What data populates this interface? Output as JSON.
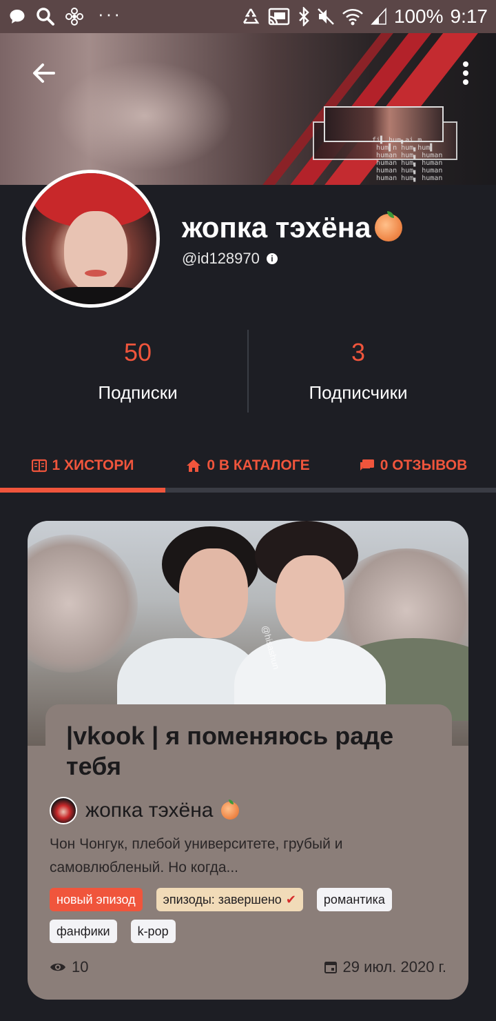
{
  "status_bar": {
    "battery": "100%",
    "time": "9:17",
    "dots": "···"
  },
  "profile": {
    "name": "жопка тэхёна",
    "handle": "@id128970",
    "info_icon": "i"
  },
  "stats": [
    {
      "value": "50",
      "label": "Подписки"
    },
    {
      "value": "3",
      "label": "Подписчики"
    }
  ],
  "tabs": [
    {
      "label": "1 хистори",
      "icon": "book-icon",
      "active": true
    },
    {
      "label": "0 в каталоге",
      "icon": "home-icon",
      "active": false
    },
    {
      "label": "0 отзывов",
      "icon": "comment-icon",
      "active": false
    }
  ],
  "story": {
    "title": "|vkook | я поменяюсь раде тебя",
    "author": "жопка тэхёна",
    "description": "Чон Чонгук, плебой университете, грубый и самовлюбленый. Но когда...",
    "watermark": "@hisashun",
    "tags": [
      {
        "label": "новый эпизод",
        "type": "new"
      },
      {
        "label": "эпизоды: завершено",
        "type": "done"
      },
      {
        "label": "романтика",
        "type": "plain"
      },
      {
        "label": "фанфики",
        "type": "plain"
      },
      {
        "label": "k-pop",
        "type": "plain"
      }
    ],
    "views": "10",
    "date": "29 июл. 2020 г."
  },
  "colors": {
    "accent": "#f0553c",
    "background": "#1d1e24",
    "status_bar": "#5b4647",
    "card": "#8b7e79"
  }
}
